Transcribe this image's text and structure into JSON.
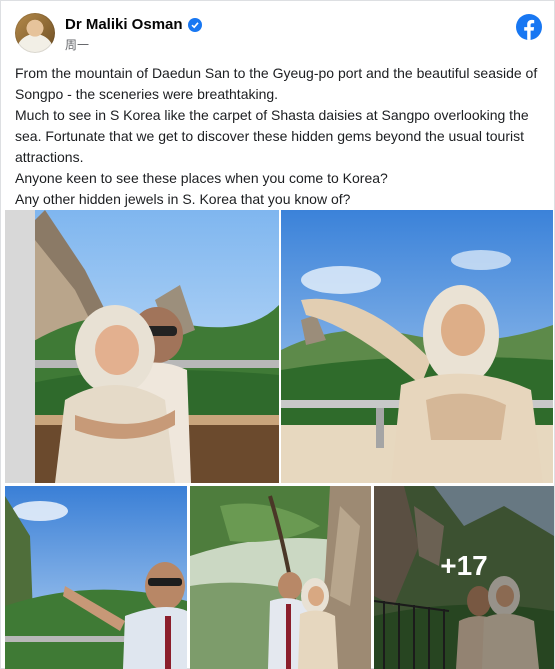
{
  "post": {
    "author": "Dr Maliki Osman",
    "timestamp": "周一",
    "paragraphs": [
      "From the mountain of Daedun San to the Gyeug-po port and the beautiful seaside of Songpo - the sceneries were breathtaking.",
      "Much to see in S Korea like the carpet of Shasta daisies at Sangpo overlooking the sea. Fortunate that we get to discover these hidden gems beyond the usual tourist attractions.",
      "Anyone keen to see these places when you come to Korea?",
      "Any other hidden jewels in S. Korea that you know of?"
    ]
  },
  "icons": {
    "verified": "verified-badge-icon",
    "brand": "facebook-logo-icon"
  },
  "colors": {
    "brand": "#1877f2",
    "secondary_text": "#65676b"
  },
  "photos": {
    "more_count": "+17"
  }
}
